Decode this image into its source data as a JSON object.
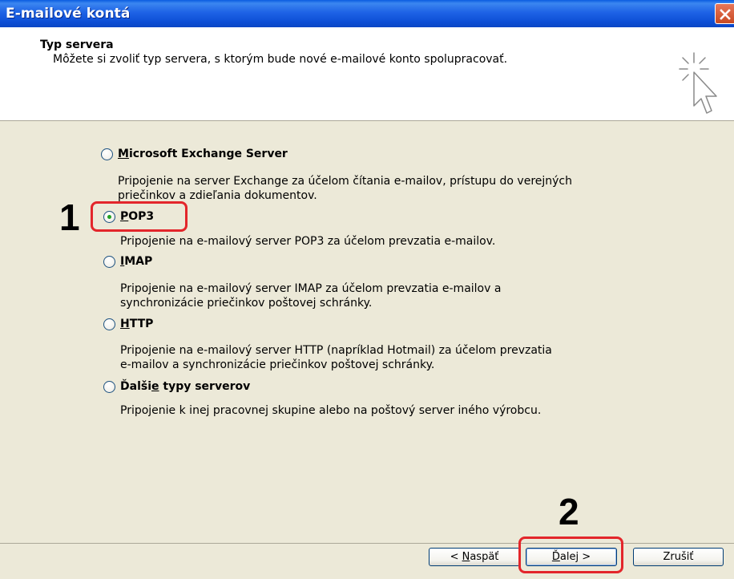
{
  "window": {
    "title": "E-mailové kontá"
  },
  "header": {
    "title": "Typ servera",
    "subtitle": "Môžete si zvoliť typ servera, s ktorým bude nové e-mailové konto spolupracovať.",
    "icon": "wizard-sparkle-cursor-icon"
  },
  "options": [
    {
      "key": "M",
      "label_rest": "icrosoft Exchange Server",
      "description_lines": [
        "Pripojenie na server Exchange za účelom čítania e-mailov, prístupu do verejných",
        "priečinkov a zdieľania dokumentov."
      ],
      "checked": false
    },
    {
      "key": "P",
      "label_rest": "OP3",
      "description_lines": [
        "Pripojenie na e-mailový server POP3 za účelom prevzatia e-mailov."
      ],
      "checked": true
    },
    {
      "key": "I",
      "label_rest": "MAP",
      "description_lines": [
        "Pripojenie na e-mailový server IMAP za účelom prevzatia e-mailov a",
        "synchronizácie priečinkov poštovej schránky."
      ],
      "checked": false
    },
    {
      "key": "H",
      "label_rest": "TTP",
      "description_lines": [
        "Pripojenie na e-mailový server HTTP (napríklad Hotmail) za účelom prevzatia",
        "e-mailov a synchronizácie priečinkov poštovej schránky."
      ],
      "checked": false
    },
    {
      "label_pre": "Ďalši",
      "key": "e",
      "label_rest": " typy serverov",
      "description_lines": [
        "Pripojenie k inej pracovnej skupine alebo na poštový server iného výrobcu."
      ],
      "checked": false
    }
  ],
  "buttons": {
    "back": {
      "pre": "< ",
      "key": "N",
      "rest": "aspäť"
    },
    "next": {
      "pre": "",
      "key": "Ď",
      "rest": "alej >"
    },
    "cancel": "Zrušiť"
  },
  "annotations": {
    "step1": "1",
    "step2": "2",
    "color": "#e3262b"
  },
  "colors": {
    "titlebar": "#0a5ce0",
    "dialog_bg": "#ece9d8",
    "radio_dot": "#21a121"
  }
}
